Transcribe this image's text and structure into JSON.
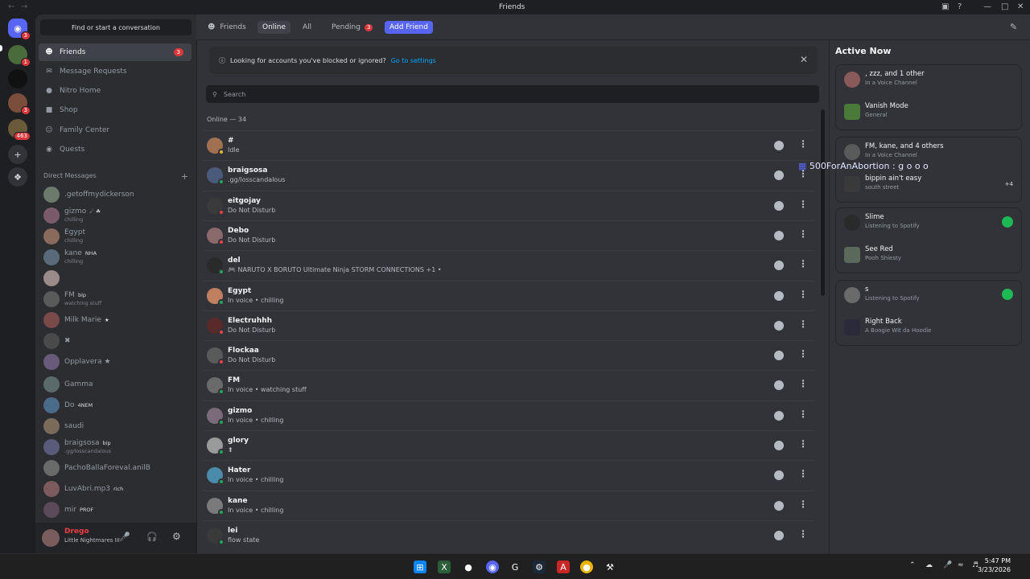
{
  "window": {
    "title": "Friends"
  },
  "servers": {
    "home_badge": "3",
    "items": [
      {
        "badge": "1"
      },
      {
        "badge": ""
      },
      {
        "badge": "3"
      },
      {
        "badge": "463"
      }
    ]
  },
  "sidebar": {
    "search_placeholder": "Find or start a conversation",
    "nav": [
      {
        "label": "Friends",
        "badge": "3"
      },
      {
        "label": "Message Requests"
      },
      {
        "label": "Nitro Home"
      },
      {
        "label": "Shop"
      },
      {
        "label": "Family Center"
      },
      {
        "label": "Quests"
      }
    ],
    "dm_header": "Direct Messages",
    "dms": [
      {
        "name": ".getoffmydickerson",
        "sub": "",
        "tag": ""
      },
      {
        "name": "gizmo",
        "sub": "chilling",
        "tag": "☄ ☘"
      },
      {
        "name": "Egypt",
        "sub": "chilling",
        "tag": ""
      },
      {
        "name": "kane",
        "sub": "chilling",
        "tag": "NHA"
      },
      {
        "name": "",
        "sub": "",
        "tag": ""
      },
      {
        "name": "FM",
        "sub": "watching stuff",
        "tag": "bip"
      },
      {
        "name": "Milk Marie",
        "sub": "",
        "tag": "★"
      },
      {
        "name": "✖",
        "sub": "",
        "tag": ""
      },
      {
        "name": "Opplavera ★",
        "sub": "",
        "tag": ""
      },
      {
        "name": "Gamma",
        "sub": "",
        "tag": ""
      },
      {
        "name": "Do",
        "sub": "",
        "tag": "4NEM"
      },
      {
        "name": "saudi",
        "sub": "",
        "tag": ""
      },
      {
        "name": "braigsosa",
        "sub": ".gg/losscandalous",
        "tag": "bip"
      },
      {
        "name": "PachoBallaForeval.anilB",
        "sub": "",
        "tag": ""
      },
      {
        "name": "LuvAbri.mp3",
        "sub": "",
        "tag": "rich"
      },
      {
        "name": "mir",
        "sub": "",
        "tag": "PROF"
      }
    ],
    "user": {
      "name": "Drego",
      "status": "Little Nightmares III"
    }
  },
  "topbar": {
    "friends_label": "Friends",
    "tabs": [
      {
        "label": "Online"
      },
      {
        "label": "All"
      },
      {
        "label": "Pending",
        "badge": "3"
      }
    ],
    "add_friend": "Add Friend"
  },
  "notice": {
    "text": "Looking for accounts you've blocked or ignored?",
    "link": "Go to settings"
  },
  "search": {
    "placeholder": "Search"
  },
  "online_header": "Online — 34",
  "friends": [
    {
      "name": "#",
      "status": "Idle",
      "dot": "#f0b232"
    },
    {
      "name": "braigsosa",
      "status": ".gg/losscandalous",
      "dot": "#23a55a"
    },
    {
      "name": "eitgojay",
      "status": "Do Not Disturb",
      "dot": "#f23f43"
    },
    {
      "name": "Debo",
      "status": "Do Not Disturb",
      "dot": "#f23f43"
    },
    {
      "name": "del",
      "status": "🎮 NARUTO X BORUTO Ultimate Ninja STORM CONNECTIONS +1 •",
      "dot": "#23a55a"
    },
    {
      "name": "Egypt",
      "status": "In voice • chilling",
      "dot": "#23a55a"
    },
    {
      "name": "Electruhhh",
      "status": "Do Not Disturb",
      "dot": "#f23f43"
    },
    {
      "name": "Flockaa",
      "status": "Do Not Disturb",
      "dot": "#f23f43"
    },
    {
      "name": "FM",
      "status": "In voice • watching stuff",
      "dot": "#23a55a"
    },
    {
      "name": "gizmo",
      "status": "In voice • chilling",
      "dot": "#23a55a"
    },
    {
      "name": "glory",
      "status": "⬆",
      "dot": "#23a55a"
    },
    {
      "name": "Hater",
      "status": "In voice • chilling",
      "dot": "#23a55a"
    },
    {
      "name": "kane",
      "status": "In voice • chilling",
      "dot": "#23a55a"
    },
    {
      "name": "lei",
      "status": "flow state",
      "dot": "#23a55a"
    }
  ],
  "active_now": {
    "title": "Active Now",
    "cards": [
      {
        "title": ", zzz, and 1 other",
        "subtitle": "In a Voice Channel",
        "row2_title": "Vanish Mode",
        "row2_sub": "General",
        "spotify": false
      },
      {
        "title": "FM, kane, and 4 others",
        "subtitle": "In a Voice Channel",
        "row2_title": "bippin ain't easy",
        "row2_sub": "south street",
        "extra": "+4",
        "spotify": false
      },
      {
        "title": "Slime",
        "subtitle": "Listening to Spotify",
        "row2_title": "See Red",
        "row2_sub": "Pooh Shiesty",
        "spotify": true
      },
      {
        "title": "s",
        "subtitle": "Listening to Spotify",
        "row2_title": "Right Back",
        "row2_sub": "A Boogie Wit da Hoodie",
        "spotify": true
      }
    ]
  },
  "overlay_text": "500ForAnAbortion : g o o o",
  "taskbar": {
    "time": "5:47 PM",
    "date": "3/23/2026"
  }
}
